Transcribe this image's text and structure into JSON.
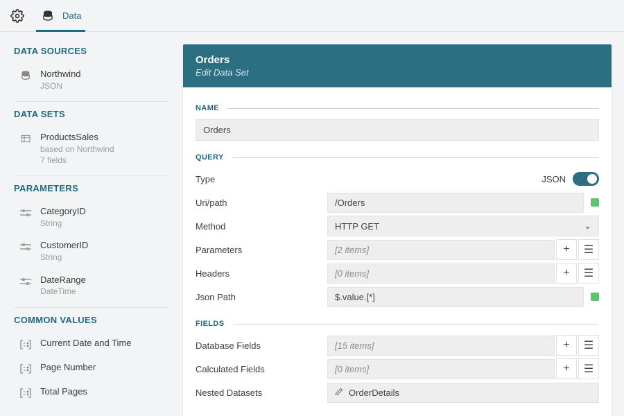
{
  "topbar": {
    "tab_label": "Data"
  },
  "sidebar": {
    "sources_heading": "DATA SOURCES",
    "sources": [
      {
        "name": "Northwind",
        "sub": "JSON"
      }
    ],
    "datasets_heading": "DATA SETS",
    "datasets": [
      {
        "name": "ProductsSales",
        "sub1": "based on Northwind",
        "sub2": "7 fields"
      }
    ],
    "parameters_heading": "PARAMETERS",
    "parameters": [
      {
        "name": "CategoryID",
        "type": "String"
      },
      {
        "name": "CustomerID",
        "type": "String"
      },
      {
        "name": "DateRange",
        "type": "DateTime"
      }
    ],
    "common_heading": "COMMON VALUES",
    "common": [
      {
        "name": "Current Date and Time"
      },
      {
        "name": "Page Number"
      },
      {
        "name": "Total Pages"
      }
    ]
  },
  "panel": {
    "title": "Orders",
    "subtitle": "Edit Data Set",
    "section_name": "NAME",
    "name_value": "Orders",
    "section_query": "QUERY",
    "type_label": "Type",
    "type_value": "JSON",
    "uri_label": "Uri/path",
    "uri_value": "/Orders",
    "method_label": "Method",
    "method_value": "HTTP GET",
    "params_label": "Parameters",
    "params_value": "[2 items]",
    "headers_label": "Headers",
    "headers_value": "[0 items]",
    "jsonpath_label": "Json Path",
    "jsonpath_value": "$.value.[*]",
    "section_fields": "FIELDS",
    "dbfields_label": "Database Fields",
    "dbfields_value": "[15 items]",
    "calcfields_label": "Calculated Fields",
    "calcfields_value": "[0 items]",
    "nested_label": "Nested Datasets",
    "nested_value": "OrderDetails"
  }
}
